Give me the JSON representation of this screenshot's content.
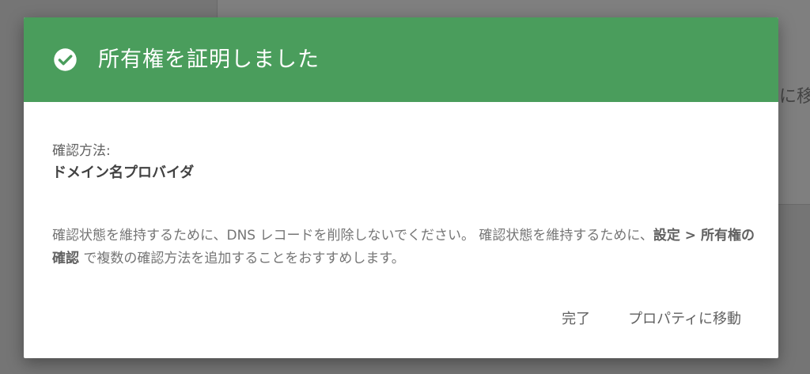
{
  "background": {
    "partial_text": "に移"
  },
  "dialog": {
    "header_color": "#4a9d5c",
    "header_icon": "check-circle-icon",
    "title": "所有権を証明しました",
    "method_label": "確認方法:",
    "method_value": "ドメイン名プロバイダ",
    "info": {
      "part1": "確認状態を維持するために、DNS レコードを削除しないでください。 確認状態を維持するために、",
      "bold": "設定 > 所有権の確認",
      "part2": " で複数の確認方法を追加することをおすすめします。"
    },
    "actions": {
      "done_label": "完了",
      "goto_property_label": "プロパティに移動"
    }
  }
}
